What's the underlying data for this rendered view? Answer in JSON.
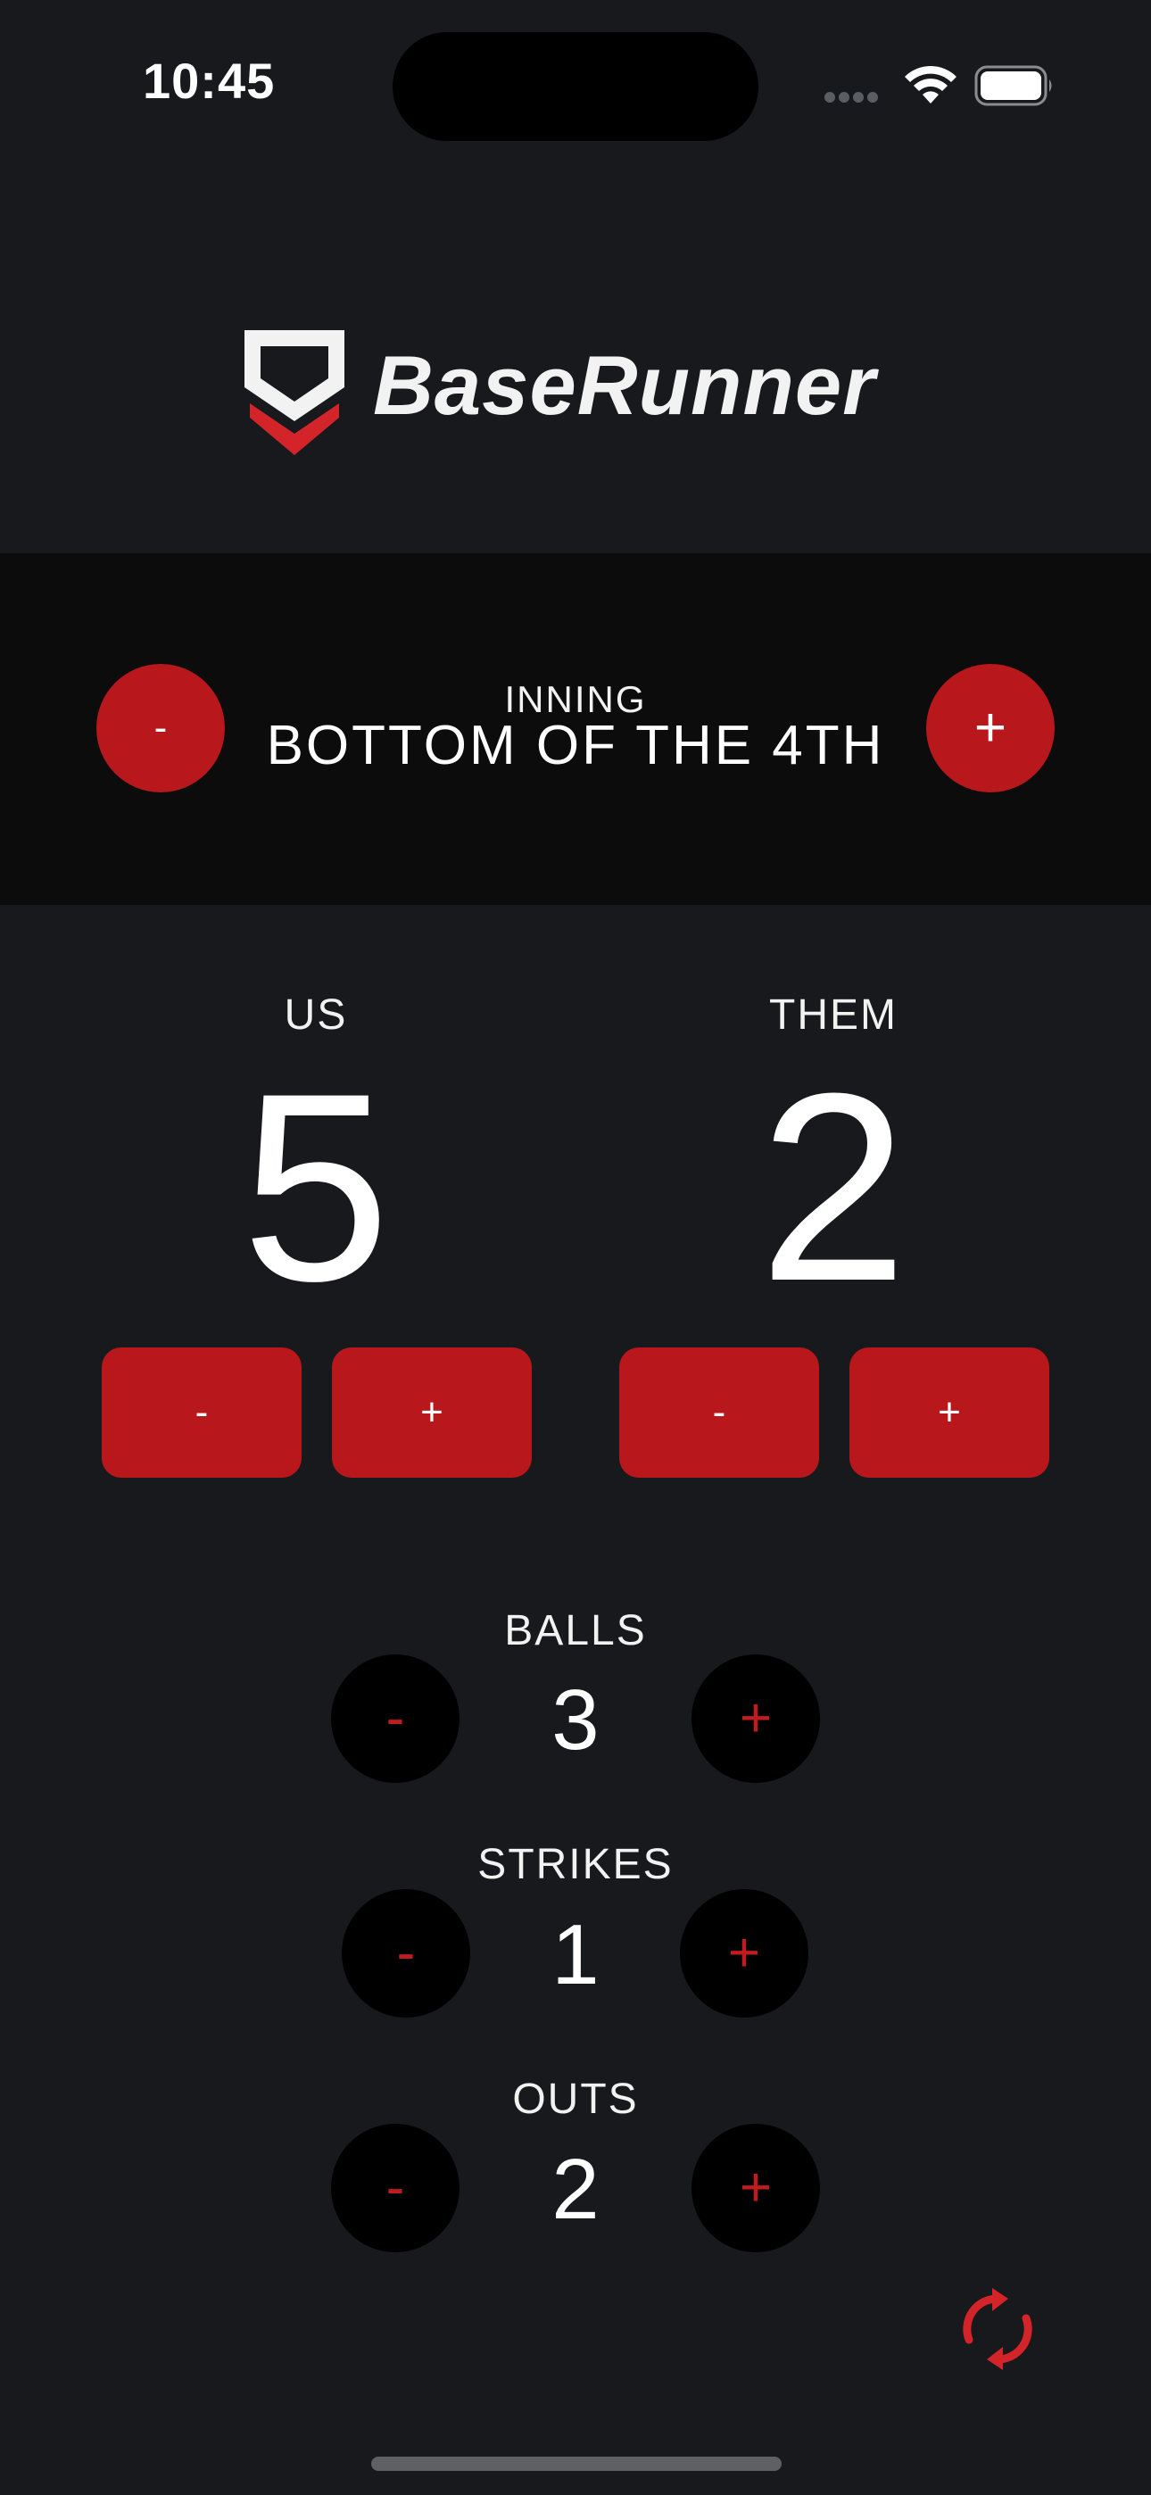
{
  "status_bar": {
    "time": "10:45",
    "signal_icon": "cellular-signal-icon",
    "wifi_icon": "wifi-icon",
    "battery_icon": "battery-full-icon"
  },
  "logo": {
    "text": "BaseRunner",
    "mark_icon": "home-plate-chevron-icon"
  },
  "inning": {
    "label": "INNING",
    "value": "BOTTOM OF THE 4TH",
    "decrement_label": "-",
    "increment_label": "+"
  },
  "teams": {
    "us": {
      "name": "US",
      "score": "5",
      "decrement_label": "-",
      "increment_label": "+"
    },
    "them": {
      "name": "THEM",
      "score": "2",
      "decrement_label": "-",
      "increment_label": "+"
    }
  },
  "counts": {
    "balls": {
      "label": "BALLS",
      "value": "3",
      "decrement_label": "-",
      "increment_label": "+"
    },
    "strikes": {
      "label": "STRIKES",
      "value": "1",
      "decrement_label": "-",
      "increment_label": "+"
    },
    "outs": {
      "label": "OUTS",
      "value": "2",
      "decrement_label": "-",
      "increment_label": "+"
    }
  },
  "reset": {
    "icon": "refresh-icon"
  },
  "colors": {
    "background": "#17191c",
    "band": "#0d0c0d",
    "accent_red": "#b8171b",
    "text": "#f2f2f2"
  }
}
